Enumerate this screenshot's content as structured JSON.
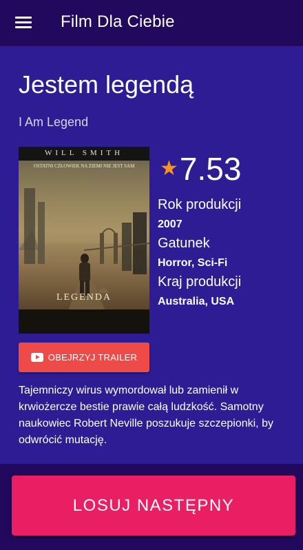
{
  "appbar": {
    "title": "Film Dla Ciebie",
    "menu_icon": "hamburger-menu-icon"
  },
  "movie": {
    "title": "Jestem legendą",
    "original_title": "I Am Legend",
    "rating": "7.53",
    "rating_icon": "star-icon",
    "rating_color": "#f7931e",
    "year_label": "Rok produkcji",
    "year": "2007",
    "genre_label": "Gatunek",
    "genre": "Horror, Sci-Fi",
    "country_label": "Kraj produkcji",
    "country": "Australia, USA",
    "description": "Tajemniczy wirus wymordował lub zamienił w krwiożercze bestie prawie całą ludzkość. Samotny naukowiec Robert Neville poszukuje szczepionki, by odwrócić mutację."
  },
  "poster": {
    "actor": "WILL SMITH",
    "tagline": "OSTATNI CZŁOWIEK NA ZIEMI NIE JEST SAM",
    "logo": "LEGENDA"
  },
  "trailer_button": {
    "label": "OBEJRZYJ TRAILER",
    "icon": "youtube-icon",
    "color": "#ee4a48"
  },
  "footer": {
    "random_button_label": "LOSUJ NASTĘPNY",
    "random_button_color": "#e91e63"
  },
  "colors": {
    "appbar": "#22095e",
    "background": "#2d1c93"
  }
}
